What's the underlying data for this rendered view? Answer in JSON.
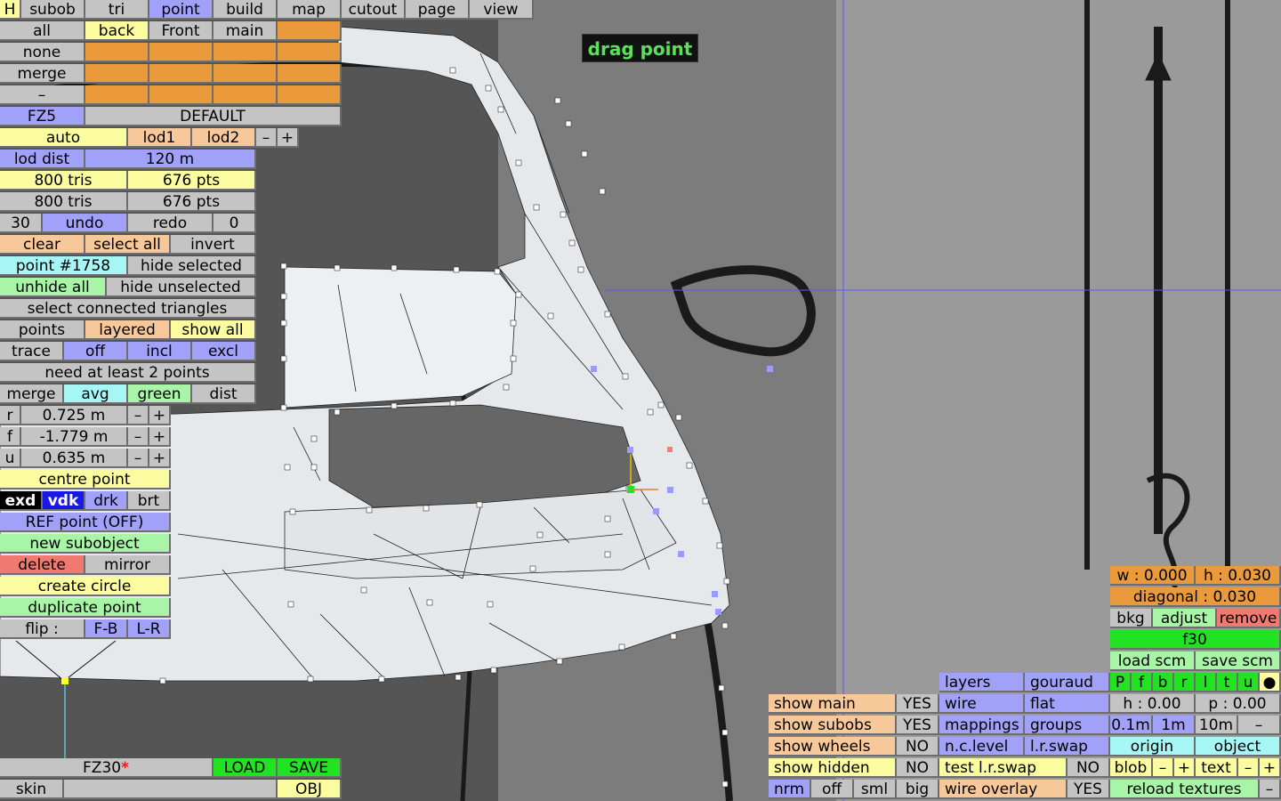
{
  "top_menu": {
    "h": "H",
    "subob": "subob",
    "tri": "tri",
    "point": "point",
    "build": "build",
    "map": "map",
    "cutout": "cutout",
    "page": "page",
    "view": "view"
  },
  "view_row": {
    "all": "all",
    "back": "back",
    "front": "Front",
    "main": "main"
  },
  "sel_rows": {
    "none": "none",
    "merge": "merge",
    "dash": "–"
  },
  "fz5_row": {
    "fz5": "FZ5",
    "default": "DEFAULT"
  },
  "lod_row": {
    "auto": "auto",
    "lod1": "lod1",
    "lod2": "lod2",
    "minus": "–",
    "plus": "+"
  },
  "lod_dist": {
    "label": "lod dist",
    "value": "120 m"
  },
  "stats": {
    "tris1": "800 tris",
    "pts1": "676 pts",
    "tris2": "800 tris",
    "pts2": "676 pts"
  },
  "undo_row": {
    "count": "30",
    "undo": "undo",
    "redo": "redo",
    "redo_count": "0"
  },
  "select_row": {
    "clear": "clear",
    "select_all": "select all",
    "invert": "invert"
  },
  "point_row": {
    "point_id": "point #1758",
    "hide_selected": "hide selected"
  },
  "unhide_row": {
    "unhide_all": "unhide all",
    "hide_unselected": "hide unselected"
  },
  "sct": "select connected triangles",
  "points_row": {
    "points": "points",
    "layered": "layered",
    "show_all": "show all"
  },
  "trace_row": {
    "trace": "trace",
    "off": "off",
    "incl": "incl",
    "excl": "excl"
  },
  "need_msg": "need at least 2 points",
  "merge_row": {
    "merge": "merge",
    "avg": "avg",
    "green": "green",
    "dist": "dist"
  },
  "coords": [
    {
      "axis": "r",
      "value": "0.725 m"
    },
    {
      "axis": "f",
      "value": "-1.779 m"
    },
    {
      "axis": "u",
      "value": "0.635 m"
    }
  ],
  "pm": {
    "minus": "–",
    "plus": "+"
  },
  "centre_point": "centre point",
  "shade_row": {
    "exd": "exd",
    "vdk": "vdk",
    "drk": "drk",
    "brt": "brt"
  },
  "ref_point": "REF point (OFF)",
  "new_subobject": "new subobject",
  "del_row": {
    "delete": "delete",
    "mirror": "mirror"
  },
  "create_circle": "create circle",
  "duplicate_point": "duplicate point",
  "flip_row": {
    "flip": "flip :",
    "fb": "F-B",
    "lr": "L-R"
  },
  "file_row": {
    "name": "FZ30",
    "modified": "*",
    "load": "LOAD",
    "save": "SAVE"
  },
  "skin_row": {
    "skin": "skin",
    "obj": "OBJ"
  },
  "drag_badge": "drag point",
  "right_panel": {
    "w": "w : 0.000",
    "h": "h : 0.030",
    "diagonal": "diagonal : 0.030",
    "bkg": "bkg",
    "adjust": "adjust",
    "remove": "remove",
    "f30": "f30",
    "load_scm": "load scm",
    "save_scm": "save scm",
    "views": [
      "P",
      "f",
      "b",
      "r",
      "l",
      "t",
      "u",
      "●"
    ],
    "h_val": "h : 0.00",
    "p_val": "p : 0.00",
    "step1": "0.1m",
    "step2": "1m",
    "step3": "10m",
    "step_minus": "–",
    "origin": "origin",
    "object": "object",
    "blob": "blob",
    "text": "text",
    "minus": "–",
    "plus": "+",
    "reload": "reload textures",
    "end_minus": "–"
  },
  "bottom_panel": {
    "show_main": "show main",
    "show_main_val": "YES",
    "show_subobs": "show subobs",
    "show_subobs_val": "YES",
    "show_wheels": "show wheels",
    "show_wheels_val": "NO",
    "show_hidden": "show hidden",
    "show_hidden_val": "NO",
    "nrm": "nrm",
    "off": "off",
    "sml": "sml",
    "big": "big",
    "layers": "layers",
    "gouraud": "gouraud",
    "wire": "wire",
    "flat": "flat",
    "mappings": "mappings",
    "groups": "groups",
    "nc_level": "n.c.level",
    "lr_swap": "l.r.swap",
    "test_lr_swap": "test l.r.swap",
    "test_val": "NO",
    "wire_overlay": "wire overlay",
    "wire_overlay_val": "YES"
  },
  "colors": {
    "viewport_bg": "#7c7c7c",
    "mesh_fill": "#e6e9ec",
    "crosshair": "#5a5aff",
    "badge_text": "#5ae05a"
  }
}
